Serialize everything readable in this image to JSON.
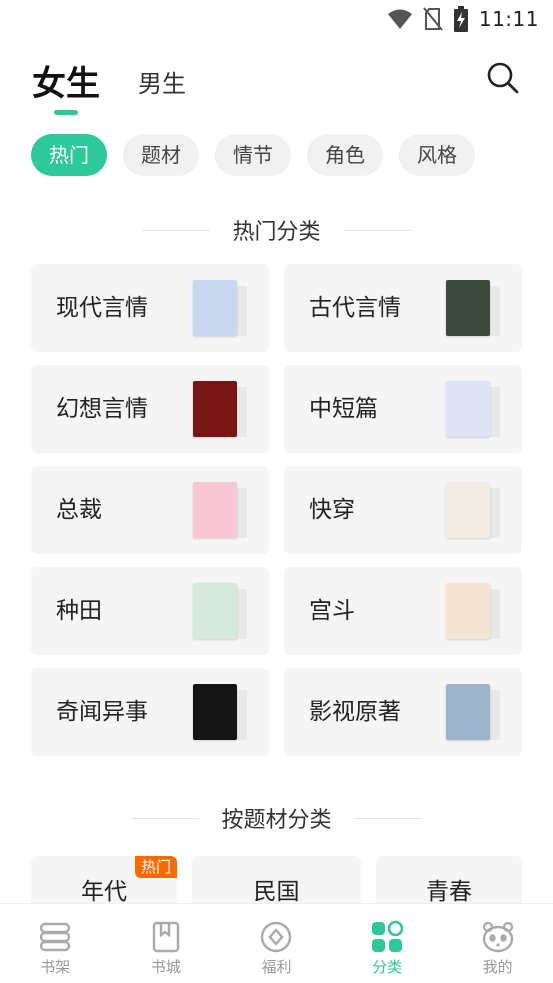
{
  "status_bar": {
    "time": "11:11"
  },
  "header": {
    "tabs": [
      {
        "label": "女生",
        "active": true
      },
      {
        "label": "男生",
        "active": false
      }
    ]
  },
  "chips": [
    {
      "label": "热门",
      "active": true
    },
    {
      "label": "题材",
      "active": false
    },
    {
      "label": "情节",
      "active": false
    },
    {
      "label": "角色",
      "active": false
    },
    {
      "label": "风格",
      "active": false
    }
  ],
  "hot_section": {
    "title": "热门分类",
    "categories": [
      {
        "label": "现代言情",
        "cover_color": "#c9d7ef"
      },
      {
        "label": "古代言情",
        "cover_color": "#3c4a3d"
      },
      {
        "label": "幻想言情",
        "cover_color": "#7a1515"
      },
      {
        "label": "中短篇",
        "cover_color": "#dfe3f3"
      },
      {
        "label": "总裁",
        "cover_color": "#f7c7d6"
      },
      {
        "label": "快穿",
        "cover_color": "#f2ede2"
      },
      {
        "label": "种田",
        "cover_color": "#d6eadc"
      },
      {
        "label": "宫斗",
        "cover_color": "#f4e4d4"
      },
      {
        "label": "奇闻异事",
        "cover_color": "#151515"
      },
      {
        "label": "影视原著",
        "cover_color": "#9eb4cc"
      }
    ]
  },
  "theme_section": {
    "title": "按题材分类",
    "items": [
      {
        "label": "年代",
        "tag": "热门"
      },
      {
        "label": "民国",
        "tag": ""
      },
      {
        "label": "青春",
        "tag": ""
      }
    ]
  },
  "bottom_nav": [
    {
      "label": "书架",
      "icon": "bookshelf-icon",
      "active": false
    },
    {
      "label": "书城",
      "icon": "book-icon",
      "active": false
    },
    {
      "label": "福利",
      "icon": "coin-icon",
      "active": false
    },
    {
      "label": "分类",
      "icon": "category-icon",
      "active": true
    },
    {
      "label": "我的",
      "icon": "panda-icon",
      "active": false
    }
  ],
  "colors": {
    "accent": "#2dc99a",
    "hot_tag": "#ff6a00",
    "card_bg": "#f5f5f5"
  }
}
